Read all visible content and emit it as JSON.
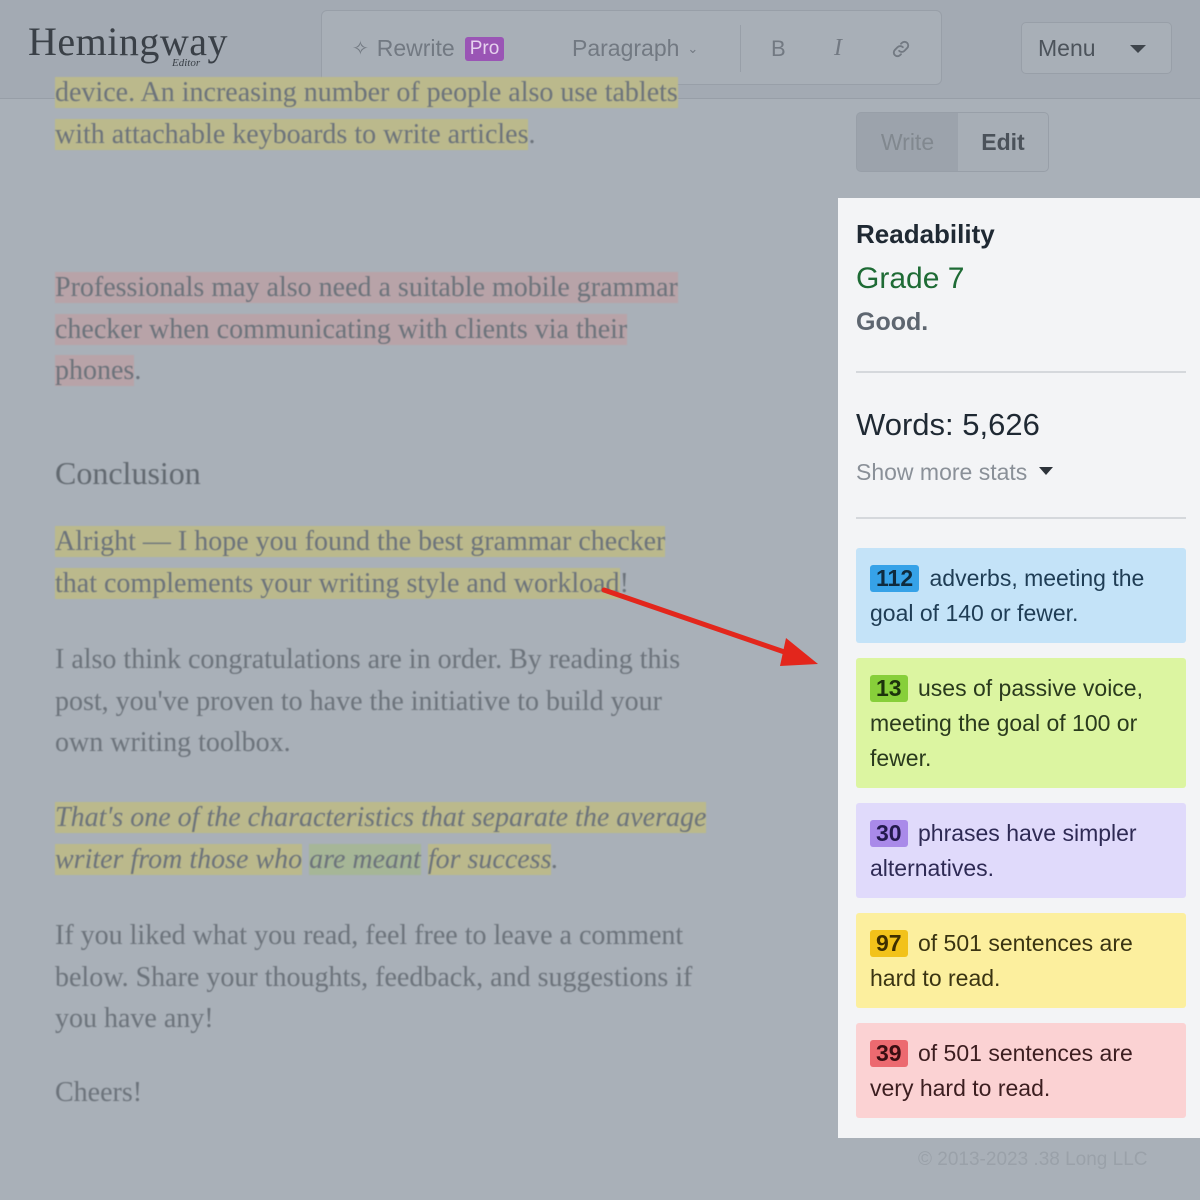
{
  "app": {
    "logo": "Hemingway",
    "logo_sub": "Editor"
  },
  "toolbar": {
    "rewrite_label": "Rewrite",
    "pro_badge": "Pro",
    "paragraph_label": "Paragraph",
    "bold_label": "B",
    "italic_label": "I",
    "menu_label": "Menu"
  },
  "mode": {
    "write_label": "Write",
    "edit_label": "Edit",
    "active": "Edit"
  },
  "editor": {
    "p1_line1": "device. An increasing number of people also use tablets",
    "p1_line2": "with attachable keyboards to write articles",
    "p2_line1": "Professionals may also need a suitable mobile grammar",
    "p2_line2": "checker when communicating with clients via their",
    "p2_line3": "phones",
    "heading": "Conclusion",
    "p3_line1": "Alright — I hope you found the best grammar checker",
    "p3_line2": "that complements your writing style and workload",
    "p4_line1": "I also think congratulations are in order. By reading this",
    "p4_line2": "post, you've proven to have the initiative to build your",
    "p4_line3": "own writing toolbox.",
    "p5_line1": "That's one of the characteristics that separate the average",
    "p5_part_a": "writer from those who",
    "p5_part_b": "are meant",
    "p5_part_c": "for success",
    "p6_line1": "If you liked what you read, feel free to leave a comment",
    "p6_line2": "below. Share your thoughts, feedback, and suggestions if",
    "p6_line3": "you have any!",
    "p7": "Cheers!"
  },
  "panel": {
    "title": "Readability",
    "grade": "Grade 7",
    "grade_desc": "Good.",
    "words": "Words: 5,626",
    "show_more": "Show more stats",
    "cards": {
      "adverbs": {
        "count": "112",
        "text": "adverbs, meeting the goal of 140 or fewer."
      },
      "passive": {
        "count": "13",
        "text": "uses of passive voice, meeting the goal of 100 or fewer."
      },
      "simpler": {
        "count": "30",
        "text": "phrases have simpler alternatives."
      },
      "hard": {
        "count": "97",
        "text": "of 501 sentences are hard to read."
      },
      "very_hard": {
        "count": "39",
        "text": "of 501 sentences are very hard to read."
      }
    }
  },
  "footer": "© 2013-2023 .38 Long LLC",
  "colors": {
    "adverb": "#36a2e8",
    "passive": "#87cf3a",
    "simpler": "#a98ae9",
    "hard": "#f2c21a",
    "very_hard": "#ec6a70",
    "grade": "#1e6b35"
  }
}
